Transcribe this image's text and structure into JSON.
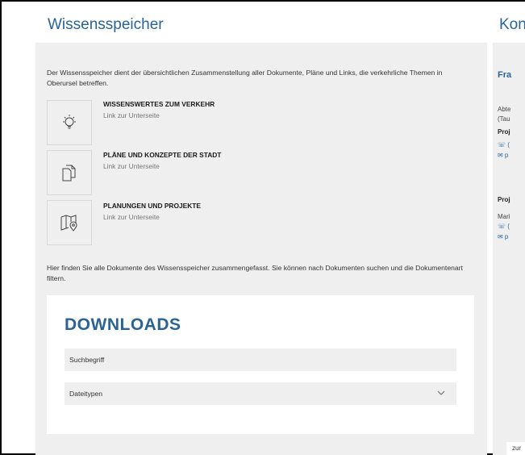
{
  "main": {
    "title": "Wissensspeicher",
    "intro": "Der Wissensspeicher dient der übersichtlichen Zusammenstellung aller Dokumente, Pläne und Links, die verkehrliche Themen in Oberursel betreffen.",
    "links": [
      {
        "title": "WISSENSWERTES ZUM VERKEHR",
        "subtitle": "Link zur Unterseite",
        "icon": "lightbulb-icon"
      },
      {
        "title": "PLÄNE UND KONZEPTE DER STADT",
        "subtitle": "Link zur Unterseite",
        "icon": "documents-icon"
      },
      {
        "title": "PLANUNGEN UND PROJEKTE",
        "subtitle": "Link zur Unterseite",
        "icon": "map-pin-icon"
      }
    ],
    "downloads_intro": "Hier finden Sie alle Dokumente des Wissensspeicher zusammengefasst. Sie können nach Dokumenten suchen und die Dokumentenart filtern."
  },
  "downloads": {
    "title": "DOWNLOADS",
    "search_placeholder": "Suchbegriff",
    "filetype_label": "Dateitypen"
  },
  "sidebar": {
    "title": "Kont",
    "name": "Fra",
    "dept_line1": "Abte",
    "dept_line2": "(Tau",
    "proj1": "Proj",
    "phone1": "☏ (",
    "mail1": "✉ p",
    "proj2": "Proj",
    "person2": "Mari",
    "phone2": "☏ (",
    "mail2": "✉ p",
    "footer": "zur"
  }
}
